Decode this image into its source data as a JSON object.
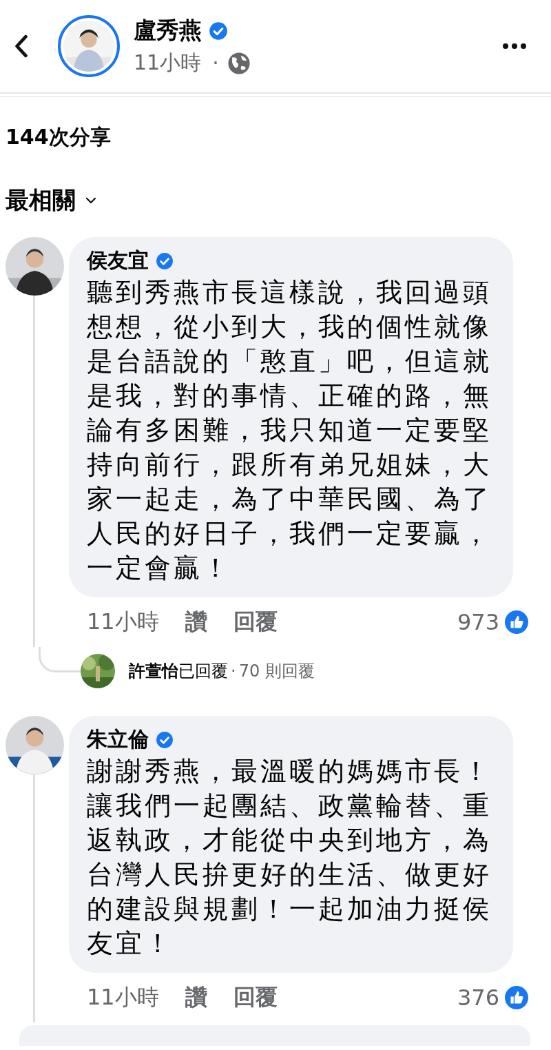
{
  "header": {
    "author": "盧秀燕",
    "verified": true,
    "time": "11小時",
    "separator": "·"
  },
  "shares": "144次分享",
  "sort": {
    "label": "最相關"
  },
  "comments": [
    {
      "author": "侯友宜",
      "verified": true,
      "text": "聽到秀燕市長這樣說，我回過頭想想，從小到大，我的個性就像是台語說的「憨直」吧，但這就是我，對的事情、正確的路，無論有多困難，我只知道一定要堅持向前行，跟所有弟兄姐妹，大家一起走，為了中華民國、為了人民的好日子，我們一定要贏，一定會贏！",
      "time": "11小時",
      "like_label": "讚",
      "reply_label": "回覆",
      "reactions": "973",
      "replies": {
        "name": "許萱怡",
        "action": "已回覆",
        "separator": "·",
        "count": "70 則回覆"
      }
    },
    {
      "author": "朱立倫",
      "verified": true,
      "text": "謝謝秀燕，最溫暖的媽媽市長！讓我們一起團結、政黨輪替、重返執政，才能從中央到地方，為台灣人民拚更好的生活、做更好的建設與規劃！一起加油力挺侯友宜！",
      "time": "11小時",
      "like_label": "讚",
      "reply_label": "回覆",
      "reactions": "376"
    }
  ]
}
